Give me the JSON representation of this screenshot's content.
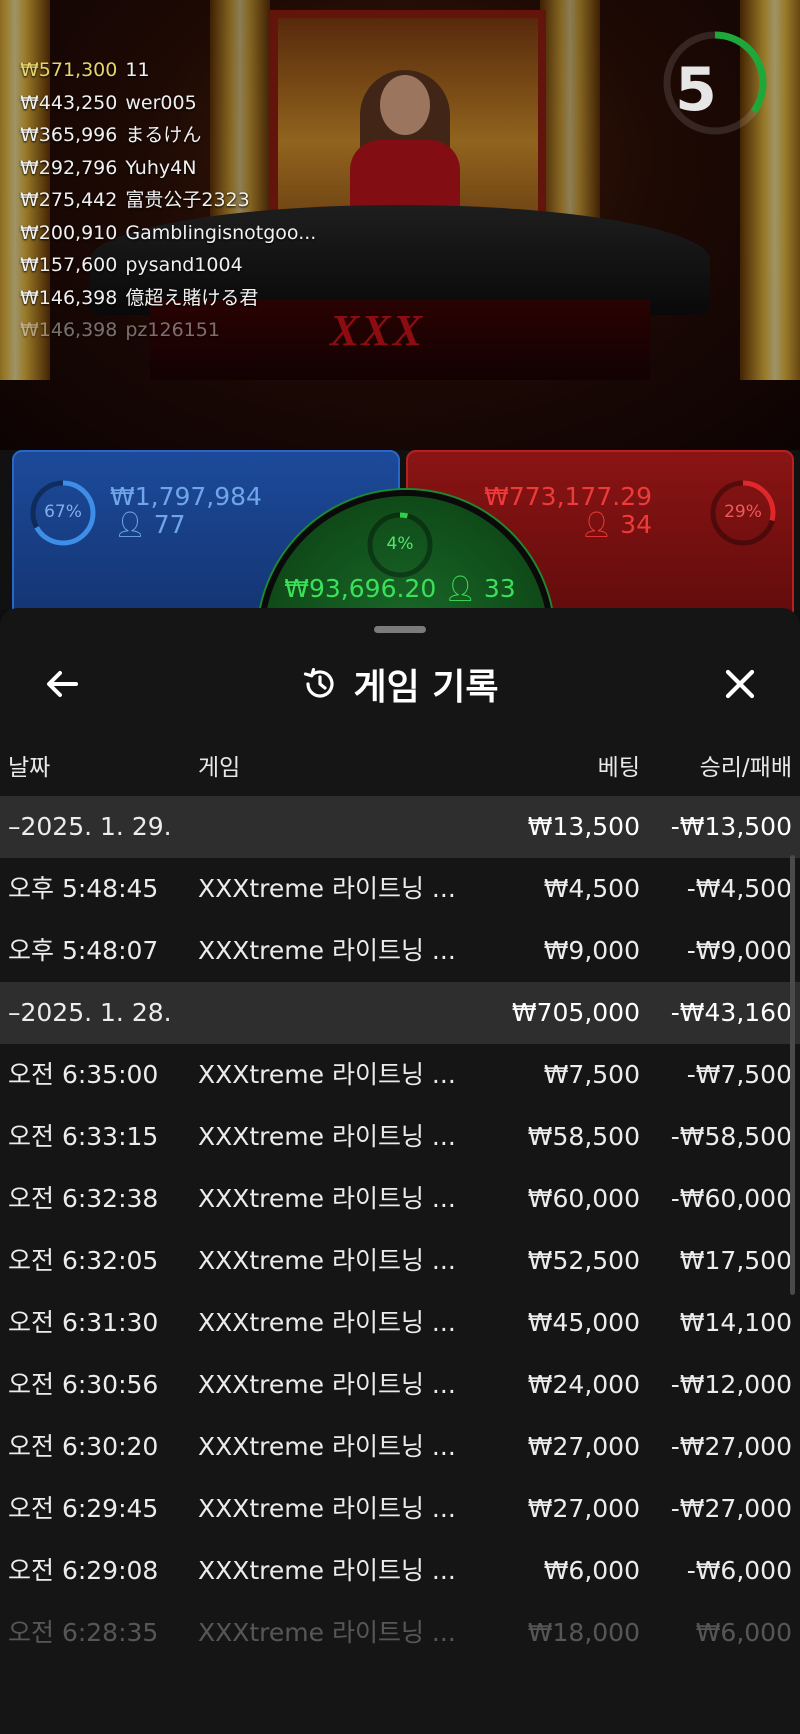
{
  "winners": [
    {
      "amount": "₩571,300",
      "name": "11",
      "fade": false,
      "highlight": true
    },
    {
      "amount": "₩443,250",
      "name": "wer005",
      "fade": false,
      "highlight": false
    },
    {
      "amount": "₩365,996",
      "name": "まるけん",
      "fade": false,
      "highlight": false
    },
    {
      "amount": "₩292,796",
      "name": "Yuhy4N",
      "fade": false,
      "highlight": false
    },
    {
      "amount": "₩275,442",
      "name": "富贵公子2323",
      "fade": false,
      "highlight": false
    },
    {
      "amount": "₩200,910",
      "name": "Gamblingisnotgoo...",
      "fade": false,
      "highlight": false
    },
    {
      "amount": "₩157,600",
      "name": "pysand1004",
      "fade": false,
      "highlight": false
    },
    {
      "amount": "₩146,398",
      "name": "億超え賭ける君",
      "fade": false,
      "highlight": false
    },
    {
      "amount": "₩146,398",
      "name": "pz126151",
      "fade": true,
      "highlight": false
    }
  ],
  "timer": {
    "value": "5",
    "remaining_fraction": 0.35,
    "color": "#1fa83a"
  },
  "stage_logo": "XXX",
  "bets": {
    "blue": {
      "percent": "67%",
      "percent_value": 0.67,
      "amount": "₩1,797,984",
      "players": "77",
      "color": "#3d8ee8"
    },
    "red": {
      "percent": "29%",
      "percent_value": 0.29,
      "amount": "₩773,177.29",
      "players": "34",
      "color": "#e0282a"
    },
    "green": {
      "percent": "4%",
      "percent_value": 0.04,
      "amount": "₩93,696.20",
      "players": "33",
      "color": "#2fcf4a"
    }
  },
  "sheet": {
    "title": "게임 기록",
    "headers": {
      "date": "날짜",
      "game": "게임",
      "bet": "베팅",
      "result": "승리/패배"
    },
    "rows": [
      {
        "type": "group",
        "c1": "–2025. 1. 29.",
        "c2": "",
        "c3": "₩13,500",
        "c4": "-₩13,500"
      },
      {
        "type": "item",
        "c1": "오후 5:48:45",
        "c2": "XXXtreme 라이트닝 ...",
        "c3": "₩4,500",
        "c4": "-₩4,500"
      },
      {
        "type": "item",
        "c1": "오후 5:48:07",
        "c2": "XXXtreme 라이트닝 ...",
        "c3": "₩9,000",
        "c4": "-₩9,000"
      },
      {
        "type": "group",
        "c1": "–2025. 1. 28.",
        "c2": "",
        "c3": "₩705,000",
        "c4": "-₩43,160"
      },
      {
        "type": "item",
        "c1": "오전 6:35:00",
        "c2": "XXXtreme 라이트닝 ...",
        "c3": "₩7,500",
        "c4": "-₩7,500"
      },
      {
        "type": "item",
        "c1": "오전 6:33:15",
        "c2": "XXXtreme 라이트닝 ...",
        "c3": "₩58,500",
        "c4": "-₩58,500"
      },
      {
        "type": "item",
        "c1": "오전 6:32:38",
        "c2": "XXXtreme 라이트닝 ...",
        "c3": "₩60,000",
        "c4": "-₩60,000"
      },
      {
        "type": "item",
        "c1": "오전 6:32:05",
        "c2": "XXXtreme 라이트닝 ...",
        "c3": "₩52,500",
        "c4": "₩17,500"
      },
      {
        "type": "item",
        "c1": "오전 6:31:30",
        "c2": "XXXtreme 라이트닝 ...",
        "c3": "₩45,000",
        "c4": "₩14,100"
      },
      {
        "type": "item",
        "c1": "오전 6:30:56",
        "c2": "XXXtreme 라이트닝 ...",
        "c3": "₩24,000",
        "c4": "-₩12,000"
      },
      {
        "type": "item",
        "c1": "오전 6:30:20",
        "c2": "XXXtreme 라이트닝 ...",
        "c3": "₩27,000",
        "c4": "-₩27,000"
      },
      {
        "type": "item",
        "c1": "오전 6:29:45",
        "c2": "XXXtreme 라이트닝 ...",
        "c3": "₩27,000",
        "c4": "-₩27,000"
      },
      {
        "type": "item",
        "c1": "오전 6:29:08",
        "c2": "XXXtreme 라이트닝 ...",
        "c3": "₩6,000",
        "c4": "-₩6,000"
      },
      {
        "type": "item fade",
        "c1": "오전 6:28:35",
        "c2": "XXXtreme 라이트닝 ...",
        "c3": "₩18,000",
        "c4": "₩6,000"
      }
    ]
  }
}
